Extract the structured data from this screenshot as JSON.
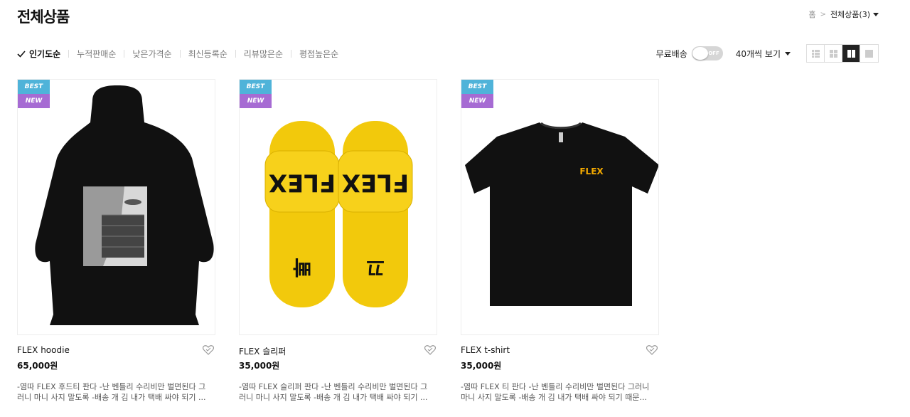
{
  "page": {
    "title": "전체상품"
  },
  "breadcrumb": {
    "home": "홈",
    "current": "전체상품(3)"
  },
  "sort": {
    "items": [
      {
        "label": "인기도순",
        "active": true
      },
      {
        "label": "누적판매순"
      },
      {
        "label": "낮은가격순"
      },
      {
        "label": "최신등록순"
      },
      {
        "label": "리뷰많은순"
      },
      {
        "label": "평점높은순"
      }
    ]
  },
  "tools": {
    "free_shipping_label": "무료배송",
    "toggle_state": "OFF",
    "per_page": "40개씩 보기"
  },
  "colors": {
    "best_badge": "#4fb3d9",
    "new_badge": "#a66bd3",
    "hoodie": "#111111",
    "slipper": "#f7d11b"
  },
  "products": [
    {
      "badge_best": "BEST",
      "badge_new": "NEW",
      "name": "FLEX hoodie",
      "price": "65,000원",
      "desc": "-염따 FLEX 후드티 판다 -난 벤틀리 수리비만 벌면된다 그러니 마니 사지 말도록 -배송 개 김 내가 택배 싸야 되기 ..."
    },
    {
      "badge_best": "BEST",
      "badge_new": "NEW",
      "name": "FLEX 슬리퍼",
      "price": "35,000원",
      "desc": "-염따 FLEX 슬리퍼 판다 -난 벤틀리 수리비만 벌면된다 그러니 마니 사지 말도록 -배송 개 김 내가 택배 싸야 되기 ...",
      "print_left": "FLEX",
      "print_right": "FLEX",
      "text_left": "빠",
      "text_right": "끄"
    },
    {
      "badge_best": "BEST",
      "badge_new": "NEW",
      "name": "FLEX t-shirt",
      "price": "35,000원",
      "desc": "-염따 FLEX 티 판다 -난 벤틀리 수리비만 벌면된다 그러니 마니 사지 말도록 -배송 개 김 내가 택배 싸야 되기 때문...",
      "print": "FLEX"
    }
  ]
}
